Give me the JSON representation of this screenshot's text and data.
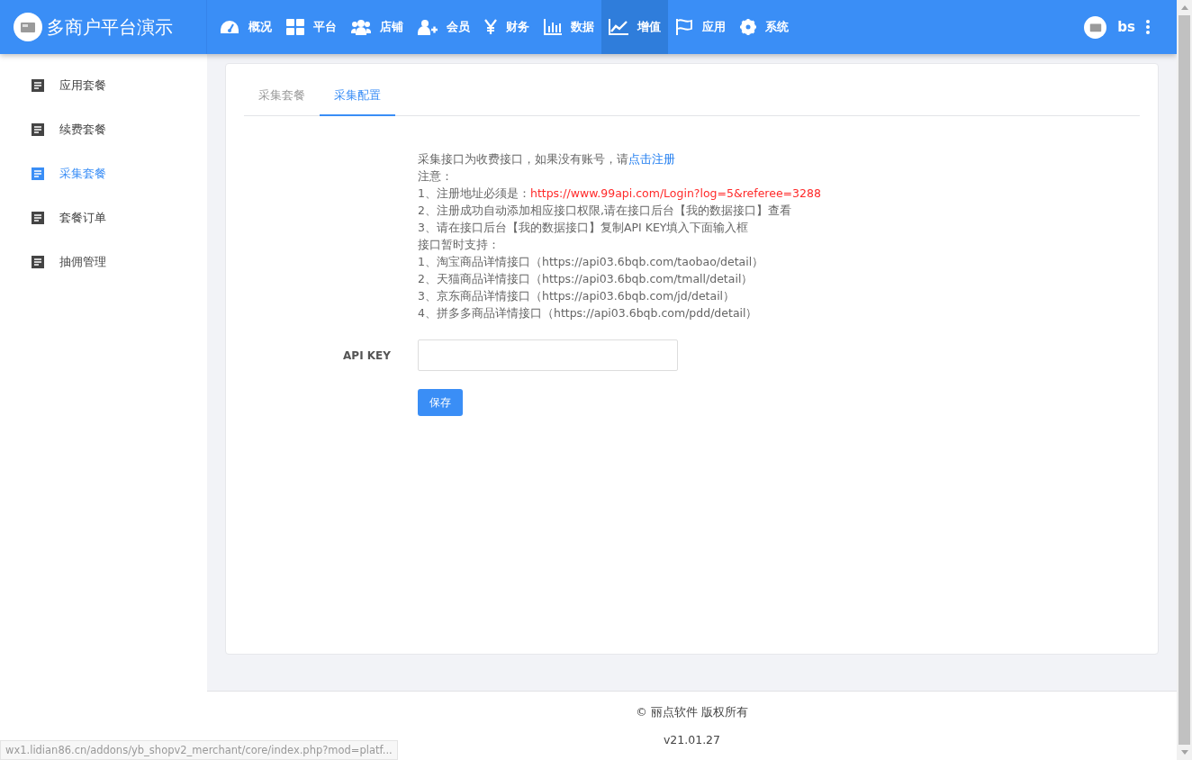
{
  "header": {
    "brand": "多商户平台演示",
    "nav": [
      {
        "label": "概况",
        "selected": false
      },
      {
        "label": "平台",
        "selected": false
      },
      {
        "label": "店铺",
        "selected": false
      },
      {
        "label": "会员",
        "selected": false
      },
      {
        "label": "财务",
        "selected": false
      },
      {
        "label": "数据",
        "selected": false
      },
      {
        "label": "增值",
        "selected": true
      },
      {
        "label": "应用",
        "selected": false
      },
      {
        "label": "系统",
        "selected": false
      }
    ],
    "user": "bs"
  },
  "sidebar": {
    "items": [
      {
        "label": "应用套餐",
        "selected": false
      },
      {
        "label": "续费套餐",
        "selected": false
      },
      {
        "label": "采集套餐",
        "selected": true
      },
      {
        "label": "套餐订单",
        "selected": false
      },
      {
        "label": "抽佣管理",
        "selected": false
      }
    ]
  },
  "tabs": [
    {
      "label": "采集套餐",
      "selected": false
    },
    {
      "label": "采集配置",
      "selected": true
    }
  ],
  "notes": [
    {
      "text": "采集接口为收费接口，如果没有账号，请",
      "link": {
        "text": "点击注册",
        "kind": "action"
      }
    },
    {
      "text": "注意："
    },
    {
      "text": "1、注册地址必须是：",
      "link": {
        "text": "https://www.99api.com/Login?log=5&referee=3288",
        "kind": "url"
      }
    },
    {
      "text": "2、注册成功自动添加相应接口权限,请在接口后台【我的数据接口】查看"
    },
    {
      "text": "3、请在接口后台【我的数据接口】复制API KEY填入下面输入框"
    },
    {
      "text": "接口暂时支持："
    },
    {
      "text": "1、淘宝商品详情接口（https://api03.6bqb.com/taobao/detail）"
    },
    {
      "text": "2、天猫商品详情接口（https://api03.6bqb.com/tmall/detail）"
    },
    {
      "text": "3、京东商品详情接口（https://api03.6bqb.com/jd/detail）"
    },
    {
      "text": "4、拼多多商品详情接口（https://api03.6bqb.com/pdd/detail）"
    }
  ],
  "form": {
    "label": "API KEY",
    "button": "保存"
  },
  "footer": {
    "copyright": "© 丽点软件 版权所有",
    "version": "v21.01.27"
  },
  "status_bar": {
    "url": "wx1.lidian86.cn/addons/yb_shopv2_merchant/core/index.php?mod=platf..."
  }
}
